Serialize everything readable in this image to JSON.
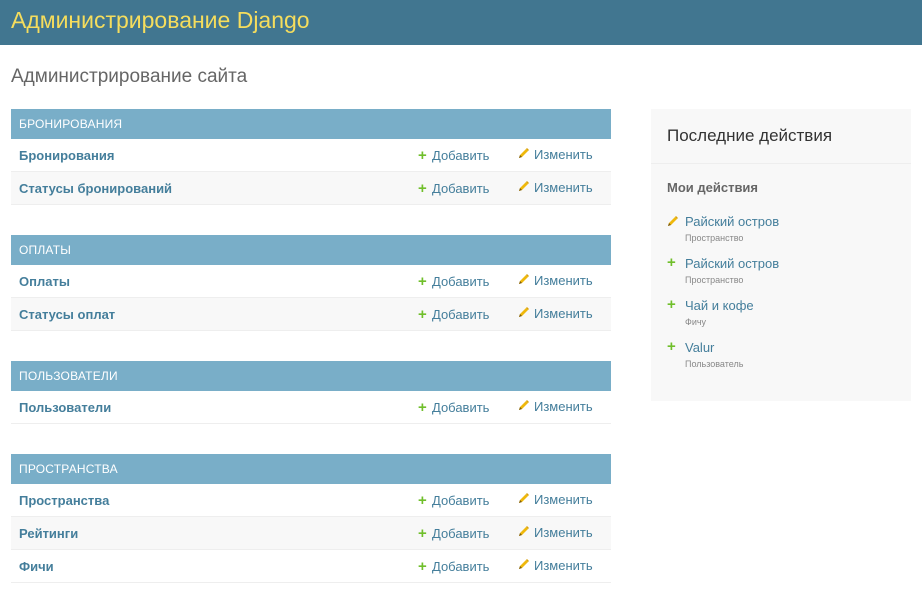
{
  "header": {
    "brand": "Администрирование Django"
  },
  "page": {
    "title": "Администрирование сайта"
  },
  "colors": {
    "header_bg": "#417690",
    "brand_text": "#f5dd5d",
    "caption_bg": "#79aec8",
    "link": "#447e9b",
    "add_icon": "#70bf2b",
    "change_icon": "#efb80b"
  },
  "modules": [
    {
      "caption": "Бронирования",
      "models": [
        {
          "name": "Бронирования",
          "add": "Добавить",
          "change": "Изменить"
        },
        {
          "name": "Статусы бронирований",
          "add": "Добавить",
          "change": "Изменить"
        }
      ]
    },
    {
      "caption": "Оплаты",
      "models": [
        {
          "name": "Оплаты",
          "add": "Добавить",
          "change": "Изменить"
        },
        {
          "name": "Статусы оплат",
          "add": "Добавить",
          "change": "Изменить"
        }
      ]
    },
    {
      "caption": "Пользователи",
      "models": [
        {
          "name": "Пользователи",
          "add": "Добавить",
          "change": "Изменить"
        }
      ]
    },
    {
      "caption": "Пространства",
      "models": [
        {
          "name": "Пространства",
          "add": "Добавить",
          "change": "Изменить"
        },
        {
          "name": "Рейтинги",
          "add": "Добавить",
          "change": "Изменить"
        },
        {
          "name": "Фичи",
          "add": "Добавить",
          "change": "Изменить"
        }
      ]
    }
  ],
  "sidebar": {
    "title": "Последние действия",
    "subtitle": "Мои действия",
    "actions": [
      {
        "icon": "pencil-icon",
        "name": "Райский остров",
        "type": "Пространство"
      },
      {
        "icon": "plus-icon",
        "name": "Райский остров",
        "type": "Пространство"
      },
      {
        "icon": "plus-icon",
        "name": "Чай и кофе",
        "type": "Фичу"
      },
      {
        "icon": "plus-icon",
        "name": "Valur",
        "type": "Пользователь"
      }
    ]
  }
}
